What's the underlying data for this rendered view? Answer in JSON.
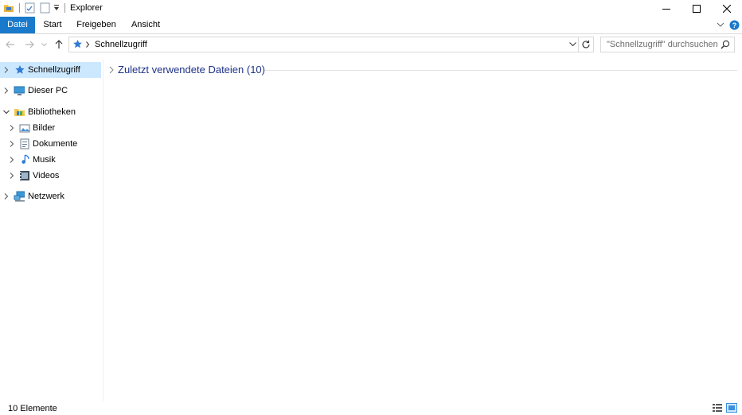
{
  "window": {
    "title": "Explorer",
    "minimize_icon": "minimize-icon",
    "maximize_icon": "maximize-icon",
    "close_icon": "close-icon"
  },
  "ribbon": {
    "tabs": [
      {
        "label": "Datei",
        "active": true
      },
      {
        "label": "Start"
      },
      {
        "label": "Freigeben"
      },
      {
        "label": "Ansicht"
      }
    ],
    "accent": "#1979ca"
  },
  "address": {
    "breadcrumb": [
      "Schnellzugriff"
    ],
    "search_placeholder": "\"Schnellzugriff\" durchsuchen"
  },
  "navpane": {
    "items": [
      {
        "label": "Schnellzugriff",
        "icon": "quick-access-star-icon",
        "expanded": false,
        "selected": true
      },
      {
        "label": "Dieser PC",
        "icon": "computer-icon",
        "expanded": false
      },
      {
        "label": "Bibliotheken",
        "icon": "libraries-icon",
        "expanded": true
      },
      {
        "label": "Bilder",
        "icon": "pictures-library-icon",
        "expanded": false
      },
      {
        "label": "Dokumente",
        "icon": "documents-library-icon",
        "expanded": false
      },
      {
        "label": "Musik",
        "icon": "music-library-icon",
        "expanded": false
      },
      {
        "label": "Videos",
        "icon": "videos-library-icon",
        "expanded": false
      },
      {
        "label": "Netzwerk",
        "icon": "network-icon",
        "expanded": false
      }
    ]
  },
  "content": {
    "group_title": "Zuletzt verwendete Dateien (10)"
  },
  "status": {
    "text": "10 Elemente"
  }
}
